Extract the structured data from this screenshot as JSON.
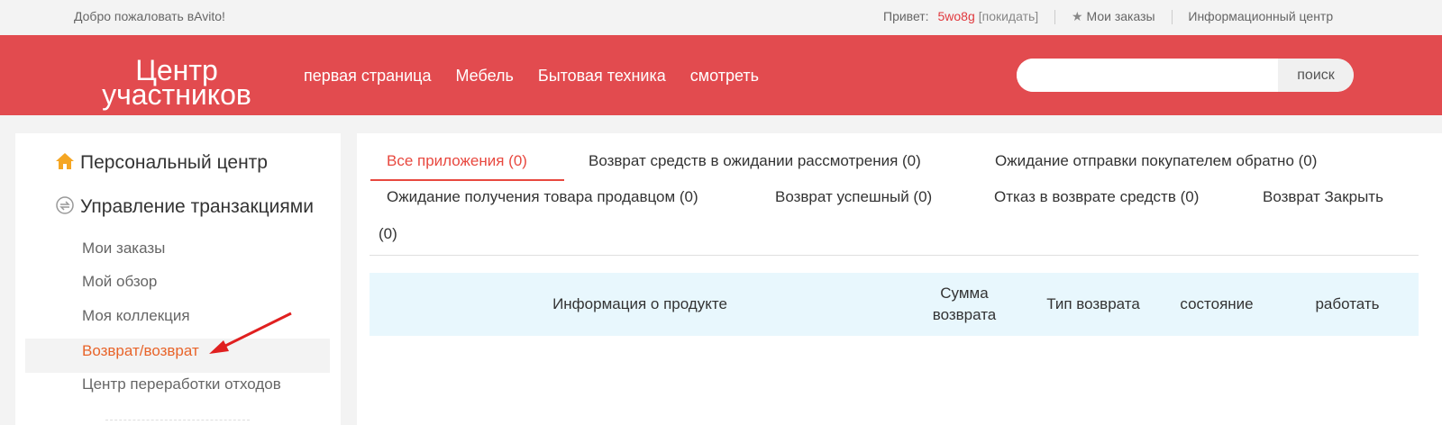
{
  "topbar": {
    "welcome": "Добро пожаловать вAvito!",
    "greeting": "Привет:",
    "username": "5wo8g",
    "logout": "[покидать]",
    "my_orders": "Мои заказы",
    "info_center": "Информационный центр"
  },
  "header": {
    "logo_line1": "Центр",
    "logo_line2": "участников",
    "nav": [
      "первая страница",
      "Мебель",
      "Бытовая техника",
      "смотреть"
    ],
    "search_placeholder": "",
    "search_button": "поиск"
  },
  "sidebar": {
    "personal_center": "Персональный центр",
    "transactions": "Управление транзакциями",
    "items": [
      "Мои заказы",
      "Мой обзор",
      "Моя коллекция",
      "Возврат/возврат",
      "Центр переработки отходов"
    ],
    "active_index": 3
  },
  "tabs": [
    "Все приложения  (0)",
    "Возврат средств в ожидании рассмотрения  (0)",
    "Ожидание отправки покупателем обратно  (0)",
    "Ожидание получения товара продавцом  (0)",
    "Возврат успешный  (0)",
    "Отказ в возврате средств  (0)",
    "Возврат Закрыть",
    "(0)"
  ],
  "table": {
    "columns": [
      "Информация о продукте",
      "Сумма возврата",
      "Тип возврата",
      "состояние",
      "работать"
    ]
  },
  "colors": {
    "header_bg": "#e24b4f",
    "accent": "#e8483f",
    "active_sidebar": "#e8642a",
    "table_header_bg": "#e8f7fd"
  }
}
